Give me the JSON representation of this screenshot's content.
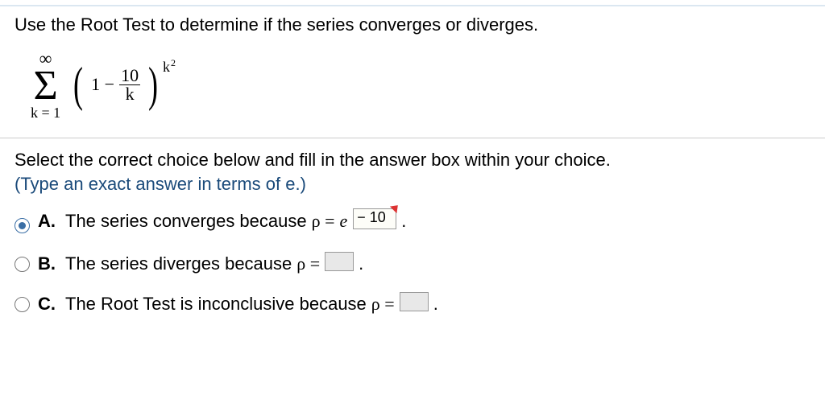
{
  "question": "Use the Root Test to determine if the series converges or diverges.",
  "formula": {
    "sum_upper": "∞",
    "sum_symbol": "Σ",
    "index": "k = 1",
    "term_open": "1 −",
    "frac_num": "10",
    "frac_den": "k",
    "exponent_base": "k",
    "exponent_sup": "2"
  },
  "prompt": "Select the correct choice below and fill in the answer box within your choice.",
  "hint": "(Type an exact answer in terms of e.)",
  "choices": {
    "a": {
      "letter": "A.",
      "text_before": "The series converges because",
      "rho_eq": "ρ =",
      "e": "e",
      "exp_value": "− 10",
      "period": "."
    },
    "b": {
      "letter": "B.",
      "text_before": "The series diverges because",
      "rho_eq": "ρ =",
      "period": "."
    },
    "c": {
      "letter": "C.",
      "text_before": "The Root Test is inconclusive because",
      "rho_eq": "ρ =",
      "period": "."
    }
  },
  "selected": "a"
}
